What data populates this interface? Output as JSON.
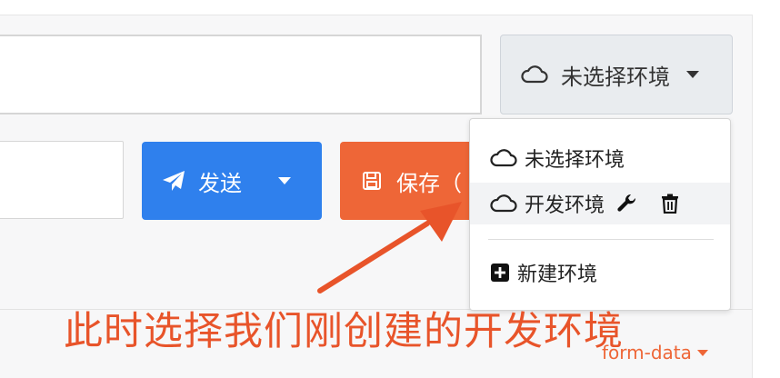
{
  "environment_select": {
    "label": "未选择环境",
    "icon": "cloud-icon"
  },
  "send_button": {
    "label": "发送",
    "icon": "paper-plane-icon"
  },
  "save_button": {
    "label": "保存（",
    "icon": "floppy-disk-icon"
  },
  "dropdown": {
    "items": [
      {
        "label": "未选择环境",
        "icon": "cloud-icon"
      },
      {
        "label": "开发环境",
        "icon": "cloud-icon",
        "actions": [
          "wrench-icon",
          "trash-icon"
        ]
      }
    ],
    "new_item": {
      "label": "新建环境",
      "icon": "plus-square-icon"
    }
  },
  "annotation": {
    "text": "此时选择我们刚创建的开发环境",
    "color": "#e8542a"
  },
  "body_type": {
    "label": "form-data"
  },
  "colors": {
    "send": "#2f80ed",
    "save": "#ee6637",
    "annotation": "#e8542a"
  }
}
